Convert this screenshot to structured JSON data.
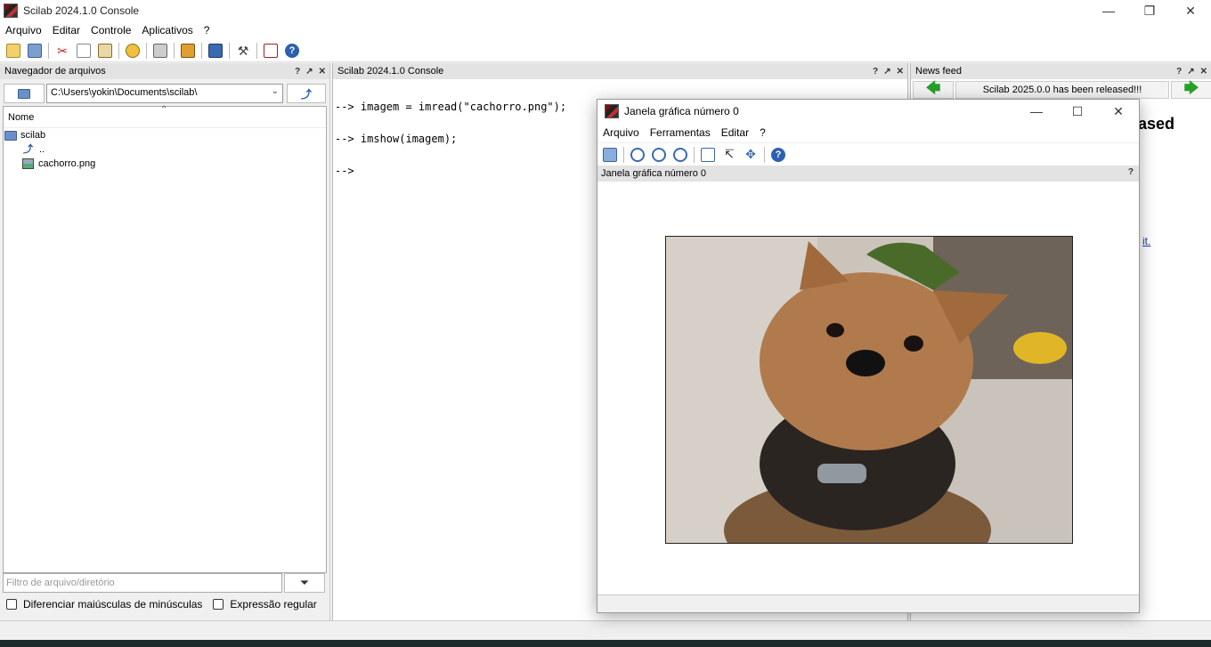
{
  "window": {
    "title": "Scilab 2024.1.0 Console"
  },
  "menubar": [
    "Arquivo",
    "Editar",
    "Controle",
    "Aplicativos",
    "?"
  ],
  "file_browser": {
    "header": "Navegador de arquivos",
    "path": "C:\\Users\\yokin\\Documents\\scilab\\",
    "column_name": "Nome",
    "tree": {
      "root": "scilab",
      "parent": "..",
      "file": "cachorro.png"
    },
    "filter_placeholder": "Filtro de arquivo/diretório",
    "case_checkbox": "Diferenciar maiúsculas de minúsculas",
    "regex_checkbox": "Expressão regular"
  },
  "console": {
    "header": "Scilab 2024.1.0 Console",
    "lines": [
      "--> imagem = imread(\"cachorro.png\");",
      "--> imshow(imagem);",
      "-->"
    ]
  },
  "news": {
    "header": "News feed",
    "item_title": "Scilab 2025.0.0 has been released!!!",
    "heading_fragment": "eased",
    "link_fragment": "it."
  },
  "graphic_window": {
    "title": "Janela gráfica número 0",
    "menu": [
      "Arquivo",
      "Ferramentas",
      "Editar",
      "?"
    ],
    "label": "Janela gráfica número 0"
  },
  "colors": {
    "panel_header": "#e3e3e3",
    "link": "#1a3fa8",
    "accent_green": "#28a028"
  }
}
